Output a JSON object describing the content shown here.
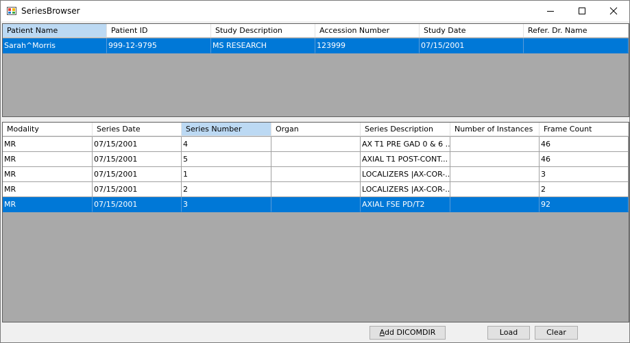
{
  "window": {
    "title": "SeriesBrowser"
  },
  "patients": {
    "columns": [
      "Patient Name",
      "Patient ID",
      "Study Description",
      "Accession Number",
      "Study Date",
      "Refer. Dr. Name"
    ],
    "rows": [
      [
        "Sarah^Morris",
        "999-12-9795",
        "MS RESEARCH",
        "123999",
        "07/15/2001",
        ""
      ]
    ],
    "selected_row": 0,
    "active_header": 0
  },
  "series": {
    "columns": [
      "Modality",
      "Series Date",
      "Series Number",
      "Organ",
      "Series Description",
      "Number of Instances",
      "Frame Count"
    ],
    "rows": [
      [
        "MR",
        "07/15/2001",
        "4",
        "",
        "AX T1 PRE GAD 0 & 6 ...",
        "",
        "46"
      ],
      [
        "MR",
        "07/15/2001",
        "5",
        "",
        "AXIAL T1 POST-CONT...",
        "",
        "46"
      ],
      [
        "MR",
        "07/15/2001",
        "1",
        "",
        "LOCALIZERS |AX-COR-...",
        "",
        "3"
      ],
      [
        "MR",
        "07/15/2001",
        "2",
        "",
        "LOCALIZERS |AX-COR-...",
        "",
        "2"
      ],
      [
        "MR",
        "07/15/2001",
        "3",
        "",
        "AXIAL FSE PD/T2",
        "",
        "92"
      ]
    ],
    "selected_row": 4,
    "active_header": 2
  },
  "buttons": {
    "add_dicomdir_prefix": "A",
    "add_dicomdir_rest": "dd DICOMDIR",
    "load": "Load",
    "clear": "Clear"
  }
}
